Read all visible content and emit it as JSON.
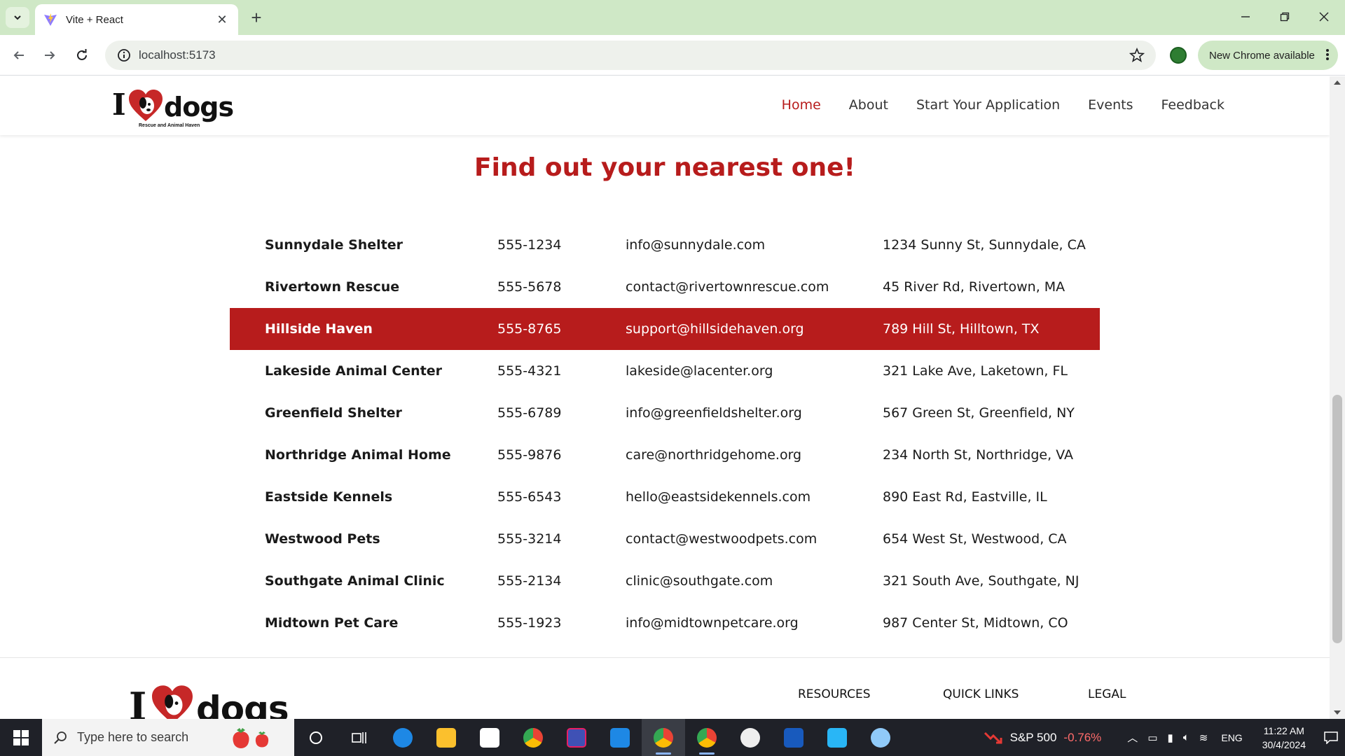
{
  "browser": {
    "tab_title": "Vite + React",
    "url": "localhost:5173",
    "update_chip": "New Chrome available"
  },
  "site": {
    "logo_i": "I",
    "logo_dogs": "dogs",
    "logo_tagline": "Rescue and Animal Haven",
    "nav": [
      {
        "label": "Home",
        "active": true
      },
      {
        "label": "About"
      },
      {
        "label": "Start Your Application"
      },
      {
        "label": "Events"
      },
      {
        "label": "Feedback"
      }
    ],
    "section_title": "Find out your nearest one!",
    "shelters": [
      {
        "name": "Sunnydale Shelter",
        "phone": "555-1234",
        "email": "info@sunnydale.com",
        "address": "1234 Sunny St, Sunnydale, CA"
      },
      {
        "name": "Rivertown Rescue",
        "phone": "555-5678",
        "email": "contact@rivertownrescue.com",
        "address": "45 River Rd, Rivertown, MA"
      },
      {
        "name": "Hillside Haven",
        "phone": "555-8765",
        "email": "support@hillsidehaven.org",
        "address": "789 Hill St, Hilltown, TX",
        "highlighted": true
      },
      {
        "name": "Lakeside Animal Center",
        "phone": "555-4321",
        "email": "lakeside@lacenter.org",
        "address": "321 Lake Ave, Laketown, FL"
      },
      {
        "name": "Greenfield Shelter",
        "phone": "555-6789",
        "email": "info@greenfieldshelter.org",
        "address": "567 Green St, Greenfield, NY"
      },
      {
        "name": "Northridge Animal Home",
        "phone": "555-9876",
        "email": "care@northridgehome.org",
        "address": "234 North St, Northridge, VA"
      },
      {
        "name": "Eastside Kennels",
        "phone": "555-6543",
        "email": "hello@eastsidekennels.com",
        "address": "890 East Rd, Eastville, IL"
      },
      {
        "name": "Westwood Pets",
        "phone": "555-3214",
        "email": "contact@westwoodpets.com",
        "address": "654 West St, Westwood, CA"
      },
      {
        "name": "Southgate Animal Clinic",
        "phone": "555-2134",
        "email": "clinic@southgate.com",
        "address": "321 South Ave, Southgate, NJ"
      },
      {
        "name": "Midtown Pet Care",
        "phone": "555-1923",
        "email": "info@midtownpetcare.org",
        "address": "987 Center St, Midtown, CO"
      }
    ],
    "footer": {
      "resources": "RESOURCES",
      "quick_links": "QUICK LINKS",
      "legal": "LEGAL"
    }
  },
  "taskbar": {
    "search_placeholder": "Type here to search",
    "stock_name": "S&P 500",
    "stock_change": "-0.76%",
    "language": "ENG",
    "time": "11:22 AM",
    "date": "30/4/2024"
  },
  "colors": {
    "brand_red": "#b71c1c",
    "chrome_green": "#cfe8c6",
    "taskbar": "#1f2128"
  }
}
